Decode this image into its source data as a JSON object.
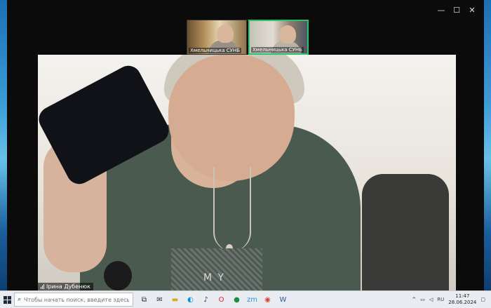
{
  "window": {
    "controls": {
      "minimize": "—",
      "maximize": "☐",
      "close": "✕"
    }
  },
  "thumbnails": [
    {
      "label": "Хмельницька СУНБ"
    },
    {
      "label": "Хмельницька СУНБ"
    }
  ],
  "main_video": {
    "participant_name": "Ірина Дубенюк",
    "shirt_text": "M Y"
  },
  "taskbar": {
    "search_placeholder": "Чтобы начать поиск, введите здесь запрос",
    "apps": [
      {
        "icon": "task-view-icon",
        "glyph": "⧉",
        "color": "#2b2b2b"
      },
      {
        "icon": "mail-icon",
        "glyph": "✉",
        "color": "#333333"
      },
      {
        "icon": "file-explorer-icon",
        "glyph": "▬",
        "color": "#d9a628"
      },
      {
        "icon": "edge-icon",
        "glyph": "◐",
        "color": "#0d8ad9"
      },
      {
        "icon": "music-icon",
        "glyph": "♪",
        "color": "#333333"
      },
      {
        "icon": "opera-icon",
        "glyph": "O",
        "color": "#e0202a"
      },
      {
        "icon": "chrome-icon",
        "glyph": "●",
        "color": "#1e8e3e"
      },
      {
        "icon": "zoom-icon",
        "glyph": "zm",
        "color": "#2d8cff"
      },
      {
        "icon": "chrome-icon-2",
        "glyph": "◉",
        "color": "#db4437"
      },
      {
        "icon": "word-icon",
        "glyph": "W",
        "color": "#2b579a"
      }
    ],
    "tray": {
      "language": "RU",
      "time": "11:47",
      "date": "28.06.2024"
    }
  }
}
